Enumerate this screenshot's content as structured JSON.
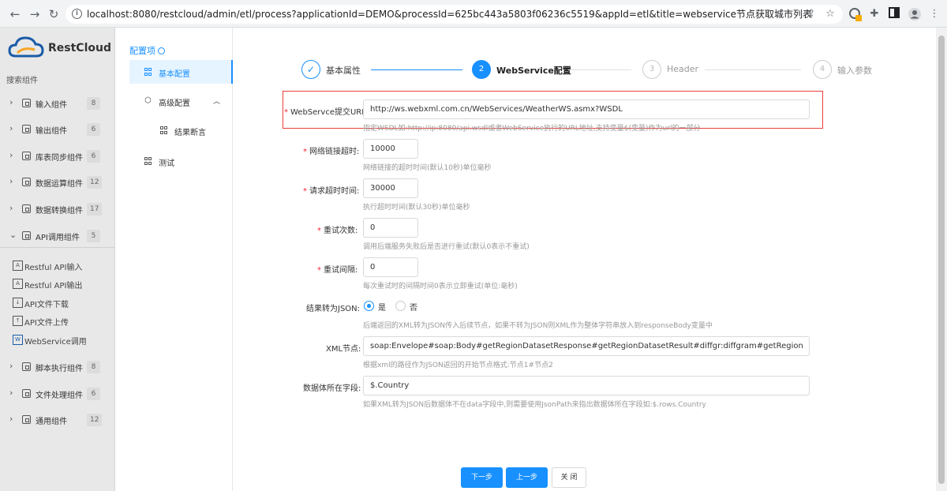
{
  "browser": {
    "url": "localhost:8080/restcloud/admin/etl/process?applicationId=DEMO&processId=625bc443a5803f06236c5519&appId=etl&title=webservice节点获取城市列表"
  },
  "sidebar": {
    "logo_text": "RestCloud",
    "search_label": "搜索组件",
    "groups_top": [
      {
        "label": "输入组件",
        "count": "8"
      },
      {
        "label": "输出组件",
        "count": "6"
      },
      {
        "label": "库表同步组件",
        "count": "6"
      },
      {
        "label": "数据运算组件",
        "count": "12"
      },
      {
        "label": "数据转换组件",
        "count": "17"
      },
      {
        "label": "API调用组件",
        "count": "5"
      }
    ],
    "sub_items": [
      {
        "label": "Restful API输入"
      },
      {
        "label": "Restful API输出"
      },
      {
        "label": "API文件下载"
      },
      {
        "label": "API文件上传"
      },
      {
        "label": "WebService调用"
      }
    ],
    "groups_bottom": [
      {
        "label": "脚本执行组件",
        "count": "8"
      },
      {
        "label": "文件处理组件",
        "count": "6"
      },
      {
        "label": "通用组件",
        "count": "12"
      }
    ]
  },
  "config_nav": {
    "title": "配置项",
    "items": [
      {
        "label": "基本配置"
      },
      {
        "label": "高级配置"
      },
      {
        "label": "结果断言"
      },
      {
        "label": "测试"
      }
    ]
  },
  "steps": [
    {
      "num": "✓",
      "title": "基本属性"
    },
    {
      "num": "2",
      "title": "WebService配置"
    },
    {
      "num": "3",
      "title": "Header"
    },
    {
      "num": "4",
      "title": "输入参数"
    }
  ],
  "form": {
    "wsdl": {
      "label": "WebServce提交URL:",
      "value": "http://ws.webxml.com.cn/WebServices/WeatherWS.asmx?WSDL",
      "help": "指定WSDL如:http://ip:8080/api.wsdl或者WebService执行的URL地址,支持变量$(变量)作为url的一部分"
    },
    "conn_timeout": {
      "label": "网络链接超时:",
      "value": "10000",
      "help": "网络链接的超时时间(默认10秒)单位毫秒"
    },
    "req_timeout": {
      "label": "请求超时时间:",
      "value": "30000",
      "help": "执行超时时间(默认30秒)单位毫秒"
    },
    "retry_count": {
      "label": "重试次数:",
      "value": "0",
      "help": "调用后端服务失败后是否进行重试(默认0表示不重试)"
    },
    "retry_interval": {
      "label": "重试间隔:",
      "value": "0",
      "help": "每次重试时的间隔时间0表示立即重试(单位:毫秒)"
    },
    "to_json": {
      "label": "结果转为JSON:",
      "yes": "是",
      "no": "否",
      "help": "后端返回的XML转为JSON传入后续节点，如果不转为JSON则XML作为整体字符串放入到responseBody变量中"
    },
    "xml_node": {
      "label": "XML节点:",
      "value": "soap:Envelope#soap:Body#getRegionDatasetResponse#getRegionDatasetResult#diffgr:diffgram#getRegion",
      "help": "根据xml的路径作为JSON返回的开始节点格式:节点1#节点2"
    },
    "data_field": {
      "label": "数据体所在字段:",
      "value": "$.Country",
      "help": "如果XML转为JSON后数据体不在data字段中,则需要使用JsonPath来指出数据体所在字段如:$.rows.Country"
    }
  },
  "buttons": {
    "next": "下一步",
    "prev": "上一步",
    "close": "关 闭"
  },
  "colors": {
    "primary": "#1890ff",
    "highlight_border": "#e8403a",
    "required": "#f5222d"
  }
}
